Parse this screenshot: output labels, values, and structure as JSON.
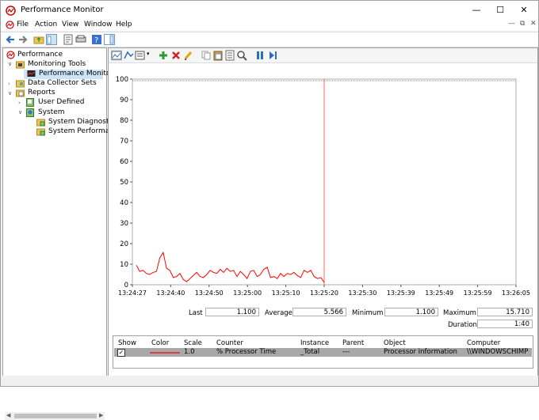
{
  "window": {
    "title": "Performance Monitor"
  },
  "menu": [
    "File",
    "Action",
    "View",
    "Window",
    "Help"
  ],
  "tree": {
    "root": "Performance",
    "items": [
      {
        "label": "Monitoring Tools"
      },
      {
        "label": "Performance Monitor"
      },
      {
        "label": "Data Collector Sets"
      },
      {
        "label": "Reports"
      },
      {
        "label": "User Defined"
      },
      {
        "label": "System"
      },
      {
        "label": "System Diagnostics"
      },
      {
        "label": "System Performance"
      }
    ]
  },
  "stats": {
    "last_label": "Last",
    "last_value": "1.100",
    "average_label": "Average",
    "average_value": "5.566",
    "minimum_label": "Minimum",
    "minimum_value": "1.100",
    "maximum_label": "Maximum",
    "maximum_value": "15.710",
    "duration_label": "Duration",
    "duration_value": "1:40"
  },
  "counters": {
    "headers": [
      "Show",
      "Color",
      "Scale",
      "Counter",
      "Instance",
      "Parent",
      "Object",
      "Computer"
    ],
    "row": {
      "scale": "1.0",
      "counter": "% Processor Time",
      "instance": "_Total",
      "parent": "---",
      "object": "Processor Information",
      "computer": "\\\\WINDOWSCHIMP"
    }
  },
  "colors": {
    "series": "#ff0000",
    "cursor": "#ff6060",
    "selected_row": "#a8a8a8"
  },
  "chart_data": {
    "type": "line",
    "ylim": [
      0,
      100
    ],
    "yticks": [
      0,
      10,
      20,
      30,
      40,
      50,
      60,
      70,
      80,
      90,
      100
    ],
    "xticks": [
      "13:24:27",
      "13:24:40",
      "13:24:50",
      "13:25:00",
      "13:25:10",
      "13:25:20",
      "13:25:30",
      "13:25:39",
      "13:25:49",
      "13:25:59",
      "13:26:05"
    ],
    "series": [
      {
        "values": [
          9.5,
          6.5,
          7,
          5.5,
          5,
          6,
          6.5,
          13,
          15.7,
          8,
          7,
          3.5,
          4,
          5.5,
          2.5,
          1.5,
          3,
          4.5,
          6,
          4,
          3.5,
          5,
          7,
          6,
          5.5,
          7.5,
          6,
          8,
          6.5,
          7,
          4,
          6.5,
          5,
          3,
          6.5,
          7,
          4,
          5,
          7.5,
          8.5,
          3.5,
          4,
          3,
          5.5,
          4,
          5.5,
          5,
          6,
          4.5,
          3.5,
          7,
          6,
          7,
          4,
          3,
          3.5,
          1.1
        ]
      }
    ],
    "grid": true,
    "cursor_fraction": 0.5
  }
}
